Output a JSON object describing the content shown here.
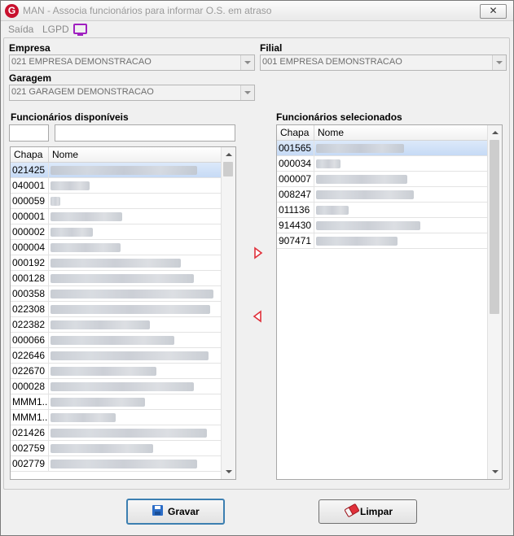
{
  "window": {
    "title": "MAN - Associa funcionários para informar O.S. em atraso",
    "app_icon_letter": "G",
    "close_glyph": "✕"
  },
  "menu": {
    "items": [
      "Saída",
      "LGPD"
    ],
    "monitor_icon": "monitor-icon"
  },
  "filters": {
    "empresa_label": "Empresa",
    "empresa_value": "021 EMPRESA DEMONSTRACAO",
    "filial_label": "Filial",
    "filial_value": "001 EMPRESA DEMONSTRACAO",
    "garagem_label": "Garagem",
    "garagem_value": "021 GARAGEM DEMONSTRACAO"
  },
  "available": {
    "title": "Funcionários disponíveis",
    "columns": [
      "Chapa",
      "Nome"
    ],
    "code_filter_value": "",
    "name_filter_value": "",
    "selected_index": 0,
    "rows": [
      "021425",
      "040001",
      "000059",
      "000001",
      "000002",
      "000004",
      "000192",
      "000128",
      "000358",
      "022308",
      "022382",
      "000066",
      "022646",
      "022670",
      "000028",
      "MMM1...",
      "MMM1...",
      "021426",
      "002759",
      "002779"
    ]
  },
  "selected": {
    "title": "Funcionários selecionados",
    "columns": [
      "Chapa",
      "Nome"
    ],
    "selected_index": 0,
    "rows": [
      "001565",
      "000034",
      "000007",
      "008247",
      "011136",
      "914430",
      "907471"
    ]
  },
  "buttons": {
    "gravar": "Gravar",
    "limpar": "Limpar"
  },
  "colors": {
    "move_arrow": "#e0303a",
    "selection": "#c6daf5",
    "primary_border": "#3c7fb1"
  }
}
